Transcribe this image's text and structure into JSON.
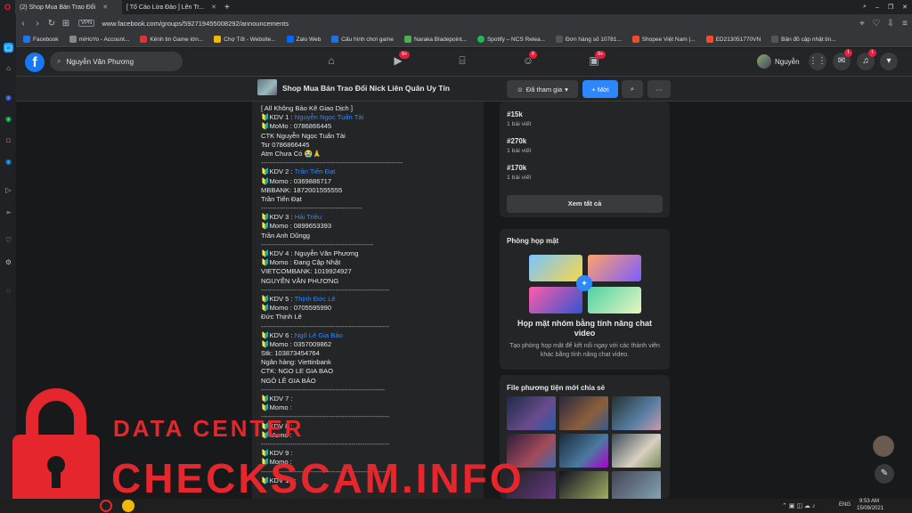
{
  "browser": {
    "tabs": [
      {
        "label": "(2) Shop Mua Bán Trao Đổi"
      },
      {
        "label": "[ Tố Cáo Lừa Đảo ] Lên Tr..."
      }
    ],
    "url": "www.facebook.com/groups/592719455008292/announcements",
    "vpn_label": "VPN",
    "bookmarks": [
      {
        "label": "Facebook",
        "color": "#1877f2"
      },
      {
        "label": "miHoYo - Account...",
        "color": "#888"
      },
      {
        "label": "Kênh tin Game lớn...",
        "color": "#d33"
      },
      {
        "label": "Chợ Tốt - Website...",
        "color": "#f5b800"
      },
      {
        "label": "Zalo Web",
        "color": "#0068ff"
      },
      {
        "label": "Cấu hình chơi game",
        "color": "#1a73e8"
      },
      {
        "label": "Naraka Bladepoint...",
        "color": "#4caf50"
      },
      {
        "label": "Spotify – NCS Relea...",
        "color": "#1db954"
      },
      {
        "label": "Đơn hàng số 10781...",
        "color": "#555"
      },
      {
        "label": "Shopee Việt Nam |...",
        "color": "#ee4d2d"
      },
      {
        "label": "ED213051770VN",
        "color": "#ee4d2d"
      },
      {
        "label": "Bản đồ cập nhật tin...",
        "color": "#555"
      }
    ]
  },
  "fb": {
    "search_value": "Nguyễn Văn Phương",
    "nav_badges": [
      "9+",
      "6",
      "9+"
    ],
    "profile_name": "Nguyễn",
    "right_badges": [
      "1",
      "1"
    ]
  },
  "group": {
    "name": "Shop Mua Bán Trao Đổi Nick Liên Quân Uy Tín",
    "joined_label": "Đã tham gia",
    "invite_label": "+ Mời"
  },
  "post": {
    "lines": [
      {
        "t": "[ All Không Bảo Kê Giao Dịch ]",
        "k": "n"
      },
      {
        "t": "🔰KDV 1 : ",
        "link": "Nguyễn Ngọc Tuấn Tài",
        "k": "l"
      },
      {
        "t": "🔰MoMo : 0786866445",
        "k": "n"
      },
      {
        "t": "CTK Nguyễn Ngọc Tuấn Tài",
        "k": "n"
      },
      {
        "t": "Tsr 0786866445",
        "k": "n"
      },
      {
        "t": "Atm Chưa Có 😭🙏",
        "k": "n"
      },
      {
        "t": "---------------------------------------------------------------",
        "k": "s"
      },
      {
        "t": "🔰KDV 2 : ",
        "link": "Trần Tiến Đạt",
        "k": "l"
      },
      {
        "t": "🔰Momo :  0369886717",
        "k": "n"
      },
      {
        "t": "MBBANK: 1872001555555",
        "k": "n"
      },
      {
        "t": "Trần Tiến Đạt",
        "k": "n"
      },
      {
        "t": "---------------------------------------------",
        "k": "s"
      },
      {
        "t": "🔰KDV 3 : ",
        "link": "Hải Triều",
        "k": "l"
      },
      {
        "t": "🔰Momo : 0899653393",
        "k": "n"
      },
      {
        "t": "Trần Anh Dũngg",
        "k": "n"
      },
      {
        "t": "--------------------------------------------------",
        "k": "s"
      },
      {
        "t": "🔰KDV 4 : Nguyễn Văn Phương",
        "k": "n"
      },
      {
        "t": "🔰Momo : Đang Cập Nhật",
        "k": "n"
      },
      {
        "t": "VIETCOMBANK: 1019924927",
        "k": "n"
      },
      {
        "t": "NGUYỄN VĂN PHƯƠNG",
        "k": "n"
      },
      {
        "t": "---------------------------------------------------------",
        "k": "s"
      },
      {
        "t": "🔰KDV 5 : ",
        "link": "Thịnh Đức Lê",
        "k": "l"
      },
      {
        "t": "🔰Momo : 0705595990",
        "k": "n"
      },
      {
        "t": "Đức Thịnh Lê",
        "k": "n"
      },
      {
        "t": "---------------------------------------------------------",
        "k": "s"
      },
      {
        "t": "🔰KDV 6 : ",
        "link": "Ngô Lê Gia Bảo",
        "k": "l"
      },
      {
        "t": "🔰Momo : 0357009862",
        "k": "n"
      },
      {
        "t": "Stk: 103873454764",
        "k": "n"
      },
      {
        "t": "Ngân hàng: Viettinbank",
        "k": "n"
      },
      {
        "t": "CTK: NGO LE GIA BAO",
        "k": "n"
      },
      {
        "t": " NGÔ LÊ GIA BẢO",
        "k": "n"
      },
      {
        "t": "-------------------------------------------------------",
        "k": "s"
      },
      {
        "t": "🔰KDV 7 :",
        "k": "n"
      },
      {
        "t": "🔰Momo :",
        "k": "n"
      },
      {
        "t": "---------------------------------------------------------",
        "k": "s"
      },
      {
        "t": "🔰KDV 8 :",
        "k": "n"
      },
      {
        "t": "🔰Momo :",
        "k": "n"
      },
      {
        "t": "---------------------------------------------------------",
        "k": "s"
      },
      {
        "t": "🔰KDV 9 :",
        "k": "n"
      },
      {
        "t": "🔰Momo :",
        "k": "n"
      },
      {
        "t": "---------------------------------------------------------",
        "k": "s"
      },
      {
        "t": "🔰KDV 10 :",
        "k": "n"
      }
    ]
  },
  "topics": {
    "items": [
      {
        "tag": "#15k",
        "count": "1 bài viết"
      },
      {
        "tag": "#270k",
        "count": "1 bài viết"
      },
      {
        "tag": "#170k",
        "count": "1 bài viết"
      }
    ],
    "see_all": "Xem tất cả"
  },
  "rooms": {
    "title": "Phòng họp mặt",
    "heading": "Họp mặt nhóm bằng tính năng chat video",
    "desc": "Tạo phòng họp mặt để kết nối ngay với các thành viên khác bằng tính năng chat video."
  },
  "media": {
    "title": "File phương tiện mới chia sẻ"
  },
  "watermark": {
    "line1": "DATA CENTER",
    "line2": "CHECKSCAM.INFO",
    "color": "#e5262c"
  },
  "taskbar": {
    "lang": "ENG",
    "time": "9:53 AM",
    "date": "15/09/2021"
  }
}
